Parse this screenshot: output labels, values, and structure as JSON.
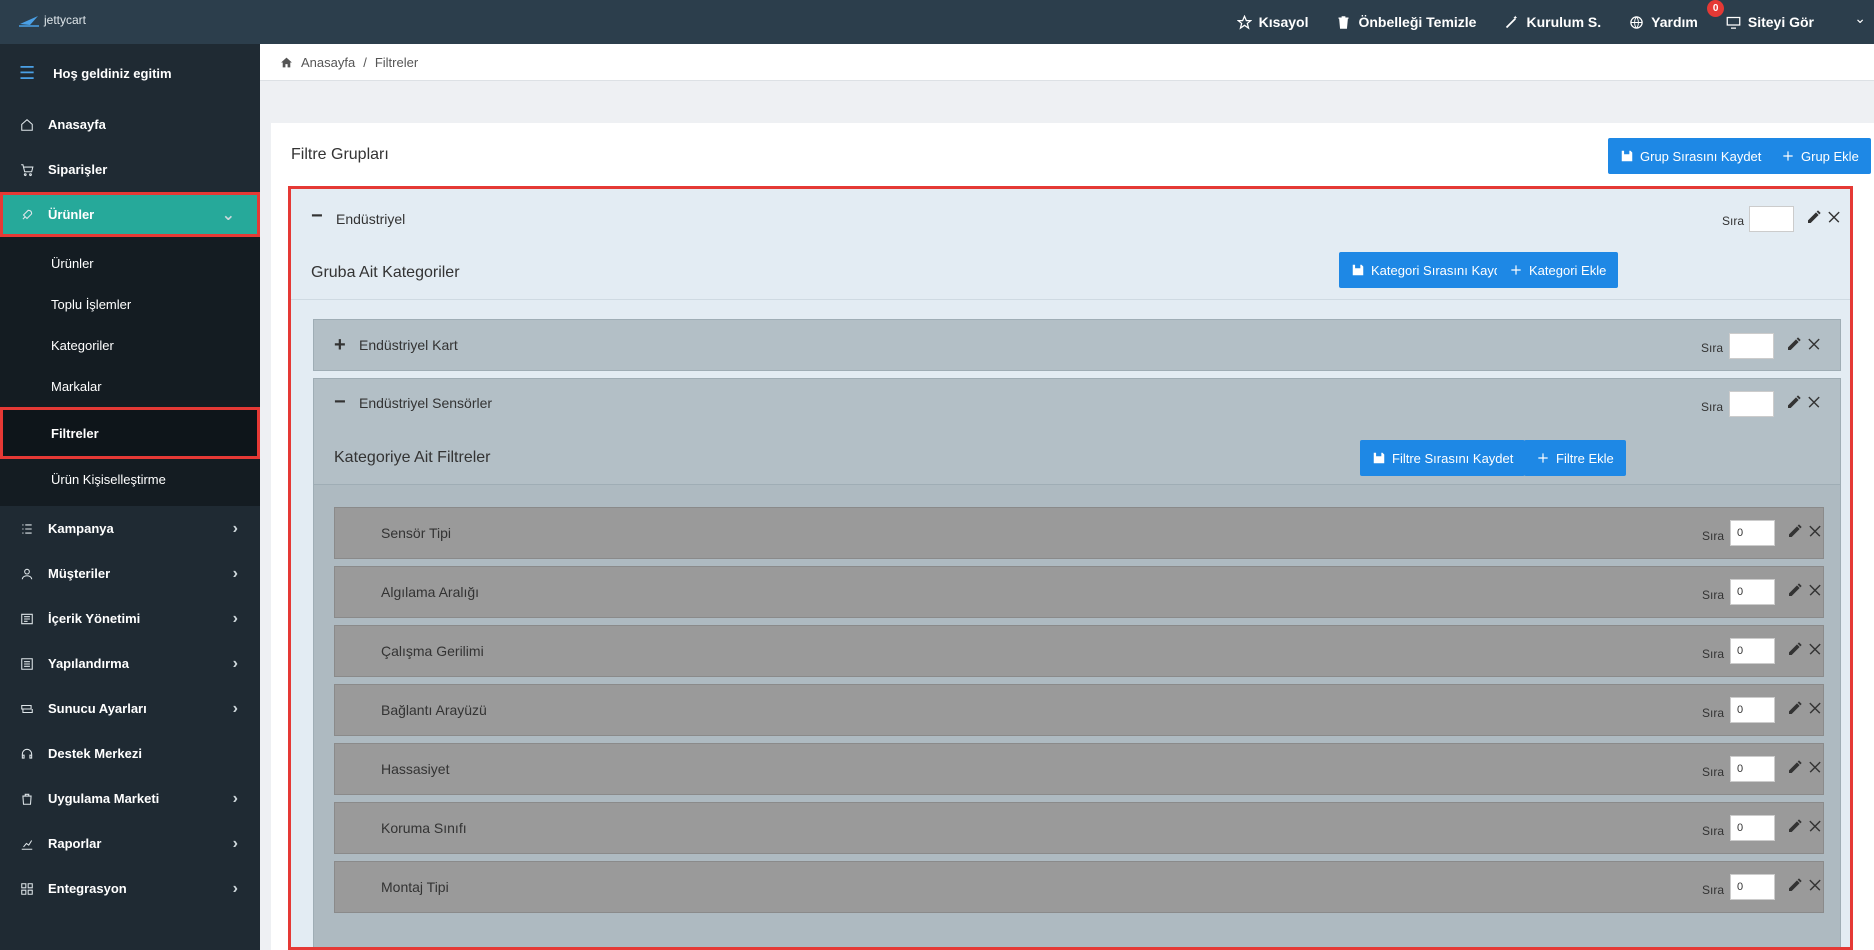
{
  "logo": {
    "text": "jettycart"
  },
  "topnav": {
    "shortcut": "Kısayol",
    "clear_cache": "Önbelleği Temizle",
    "setup": "Kurulum S.",
    "help": "Yardım",
    "help_badge": "0",
    "view_site": "Siteyi Gör"
  },
  "sidebar": {
    "welcome": "Hoş geldiniz egitim",
    "items": [
      {
        "label": "Anasayfa",
        "icon": "home-icon"
      },
      {
        "label": "Siparişler",
        "icon": "cart-icon"
      },
      {
        "label": "Ürünler",
        "icon": "rocket-icon"
      },
      {
        "label": "Kampanya",
        "icon": "list-icon"
      },
      {
        "label": "Müşteriler",
        "icon": "user-icon"
      },
      {
        "label": "İçerik Yönetimi",
        "icon": "content-icon"
      },
      {
        "label": "Yapılandırma",
        "icon": "config-icon"
      },
      {
        "label": "Sunucu Ayarları",
        "icon": "server-icon"
      },
      {
        "label": "Destek Merkezi",
        "icon": "headset-icon"
      },
      {
        "label": "Uygulama Marketi",
        "icon": "bag-icon"
      },
      {
        "label": "Raporlar",
        "icon": "chart-icon"
      },
      {
        "label": "Entegrasyon",
        "icon": "integration-icon"
      }
    ],
    "submenu": [
      "Ürünler",
      "Toplu İşlemler",
      "Kategoriler",
      "Markalar",
      "Filtreler",
      "Ürün Kişiselleştirme"
    ]
  },
  "breadcrumb": {
    "home": "Anasayfa",
    "separator": "/",
    "current": "Filtreler"
  },
  "main": {
    "title": "Filtre Grupları",
    "save_group_order": "Grup Sırasını Kaydet",
    "add_group": "Grup Ekle",
    "group": {
      "name": "Endüstriyel",
      "sira_label": "Sıra",
      "sira_value": "",
      "categories_title": "Gruba Ait Kategoriler",
      "save_category_order": "Kategori Sırasını Kaydet",
      "add_category": "Kategori Ekle",
      "categories": [
        {
          "name": "Endüstriyel Kart",
          "sira": ""
        },
        {
          "name": "Endüstriyel Sensörler",
          "sira": ""
        }
      ],
      "filters_title": "Kategoriye Ait Filtreler",
      "save_filter_order": "Filtre Sırasını Kaydet",
      "add_filter": "Filtre Ekle",
      "filters": [
        {
          "name": "Sensör Tipi",
          "sira": "0"
        },
        {
          "name": "Algılama Aralığı",
          "sira": "0"
        },
        {
          "name": "Çalışma Gerilimi",
          "sira": "0"
        },
        {
          "name": "Bağlantı Arayüzü",
          "sira": "0"
        },
        {
          "name": "Hassasiyet",
          "sira": "0"
        },
        {
          "name": "Koruma Sınıfı",
          "sira": "0"
        },
        {
          "name": "Montaj Tipi",
          "sira": "0"
        }
      ]
    }
  },
  "colors": {
    "topbar": "#2c3e4c",
    "sidebar": "#1f2a33",
    "active_item": "#26a99a",
    "button": "#1e88e5",
    "highlight": "#e53935"
  }
}
